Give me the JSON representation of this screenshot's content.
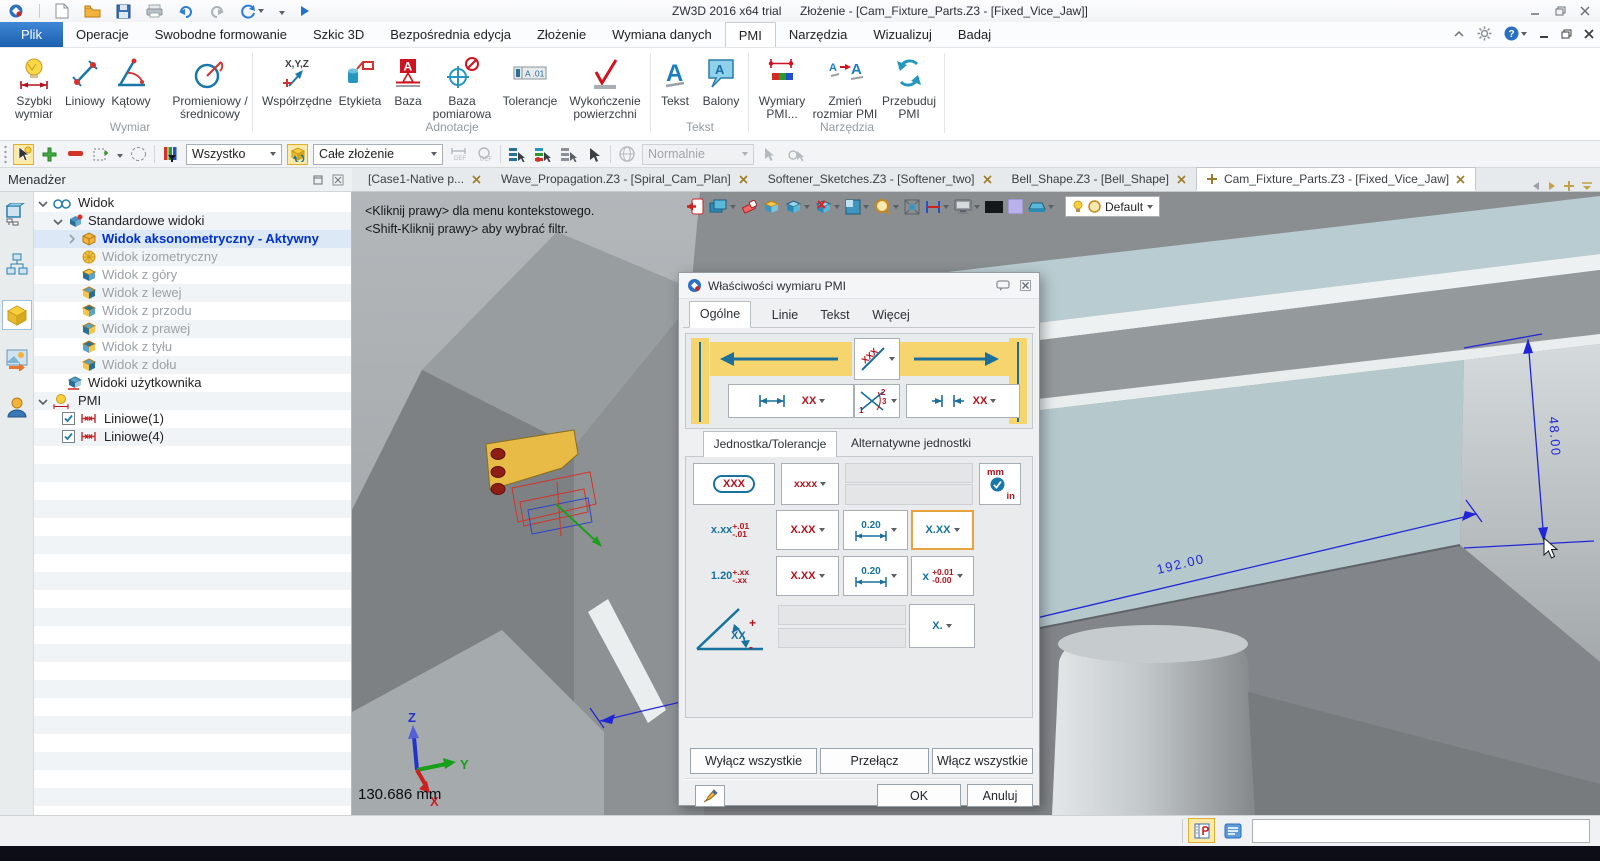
{
  "titlebar": {
    "app_title": "ZW3D 2016  x64 trial",
    "doc_title": "Złożenie - [Cam_Fixture_Parts.Z3 - [Fixed_Vice_Jaw]]"
  },
  "menubar": {
    "items": [
      "Plik",
      "Operacje",
      "Swobodne formowanie",
      "Szkic 3D",
      "Bezpośrednia edycja",
      "Złożenie",
      "Wymiana danych",
      "PMI",
      "Narzędzia",
      "Wizualizuj",
      "Badaj"
    ]
  },
  "ribbon": {
    "buttons": [
      "Szybki wymiar",
      "Liniowy",
      "Kątowy",
      "Promieniowy /średnicowy",
      "Współrzędne",
      "Etykieta",
      "Baza",
      "Baza pomiarowa",
      "Tolerancje",
      "Wykończenie powierzchni",
      "Tekst",
      "Balony",
      "Wymiary PMI...",
      "Zmień rozmiar PMI",
      "Przebuduj PMI"
    ],
    "groups": [
      "Wymiar",
      "Adnotacje",
      "Tekst",
      "Narzędzia"
    ],
    "icon_glyphs": {
      "xyz": "X,Y,Z",
      "letter_a": "A",
      "tol": "A .01"
    }
  },
  "toolbar": {
    "filter": "Wszystko",
    "scope": "Całe złożenie",
    "mode": "Normalnie"
  },
  "doc_tabs": {
    "tabs": [
      "[Case1-Native p...",
      "Wave_Propagation.Z3 - [Spiral_Cam_Plan]",
      "Softener_Sketches.Z3 - [Softener_two]",
      "Bell_Shape.Z3 - [Bell_Shape]",
      "Cam_Fixture_Parts.Z3 - [Fixed_Vice_Jaw]"
    ]
  },
  "manager": {
    "title": "Menadżer",
    "tree": [
      "Widok",
      "Standardowe widoki",
      "Widok aksonometryczny - Aktywny",
      "Widok izometryczny",
      "Widok z góry",
      "Widok z lewej",
      "Widok z przodu",
      "Widok z prawej",
      "Widok z tyłu",
      "Widok z dołu",
      "Widoki użytkownika",
      "PMI",
      "Liniowe(1)",
      "Liniowe(4)"
    ]
  },
  "viewport": {
    "hint1": "<Kliknij prawy> dla menu kontekstowego.",
    "hint2": "<Shift-Kliknij prawy> aby wybrać filtr.",
    "dim_length": "192.00",
    "dim_height": "48.00",
    "axis_x": "X",
    "axis_y": "Y",
    "axis_z": "Z",
    "measurement": "130.686 mm",
    "display_mode": "Default"
  },
  "dialog": {
    "title": "Właściwości wymiaru PMI",
    "tabs": [
      "Ogólne",
      "Linie",
      "Tekst",
      "Więcej"
    ],
    "subtabs": [
      "Jednostka/Tolerancje",
      "Alternatywne jednostki"
    ],
    "preview": {
      "text_glyph": "XXX",
      "left_style": "XX",
      "right_style": "XX",
      "leader1": "1",
      "leader2": "2",
      "leader3": "3"
    },
    "units": {
      "frame": "XXX",
      "format": "xxxx",
      "mm": "mm",
      "in": "in"
    },
    "tol_row1": {
      "main": "x.xx",
      "plus": "+.01",
      "minus": "-.01",
      "dd1": "X.XX",
      "dd2": "0.20",
      "dd3": "X.XX"
    },
    "tol_row2": {
      "main": "1.20",
      "plus": "+.xx",
      "minus": "-.xx",
      "dd1": "X.XX",
      "dd2": "0.20",
      "dd3_main": "x",
      "dd3_plus": "+0.01",
      "dd3_minus": "-0.00"
    },
    "angle": {
      "glyph": "XX",
      "plus": "+",
      "minus": "-",
      "dd": "X."
    },
    "buttons": {
      "disable_all": "Wyłącz wszystkie",
      "toggle": "Przełącz",
      "enable_all": "Włącz wszystkie",
      "ok": "OK",
      "cancel": "Anuluj"
    }
  }
}
